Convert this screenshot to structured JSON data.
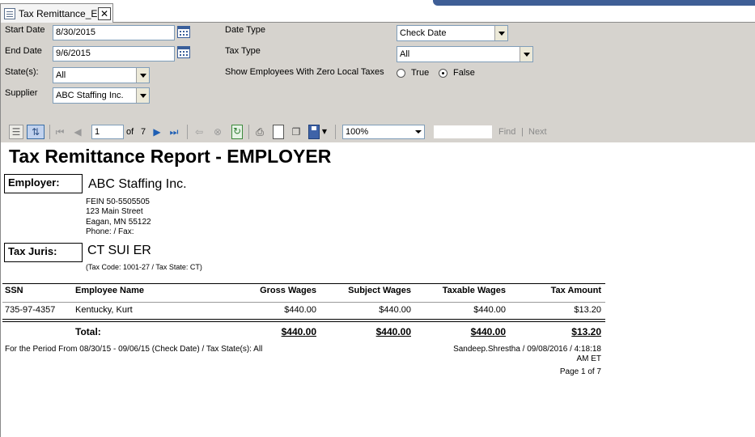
{
  "tab": {
    "title": "Tax Remittance_ER"
  },
  "params": {
    "start_date": {
      "label": "Start Date",
      "value": "8/30/2015"
    },
    "end_date": {
      "label": "End Date",
      "value": "9/6/2015"
    },
    "states": {
      "label": "State(s):",
      "value": "All"
    },
    "supplier": {
      "label": "Supplier",
      "value": "ABC Staffing Inc."
    },
    "date_type": {
      "label": "Date Type",
      "value": "Check Date"
    },
    "tax_type": {
      "label": "Tax Type",
      "value": "All"
    },
    "zero_local": {
      "label": "Show Employees With Zero Local Taxes",
      "true_label": "True",
      "false_label": "False",
      "selected": "False"
    }
  },
  "toolbar": {
    "page_current": "1",
    "page_of": "of",
    "page_total": "7",
    "zoom": "100%",
    "find_label": "Find",
    "separator": "|",
    "next_label": "Next"
  },
  "report": {
    "title": "Tax Remittance Report - EMPLOYER",
    "employer_label": "Employer:",
    "employer_name": "ABC Staffing Inc.",
    "fein": "FEIN 50-5505505",
    "address1": "123 Main Street",
    "address2": "Eagan, MN 55122",
    "phone": "Phone:  / Fax:",
    "tax_juris_label": "Tax Juris:",
    "tax_juris_name": "CT SUI ER",
    "tax_code_line": "(Tax Code: 1001-27 / Tax State: CT)",
    "columns": [
      "SSN",
      "Employee Name",
      "Gross Wages",
      "Subject Wages",
      "Taxable Wages",
      "Tax Amount"
    ],
    "rows": [
      {
        "ssn": "735-97-4357",
        "name": "Kentucky, Kurt",
        "gross": "$440.00",
        "subject": "$440.00",
        "taxable": "$440.00",
        "tax": "$13.20"
      }
    ],
    "totals": {
      "label": "Total:",
      "gross": "$440.00",
      "subject": "$440.00",
      "taxable": "$440.00",
      "tax": "$13.20"
    },
    "footer_period": "For the Period From 08/30/15 - 09/06/15 (Check Date) / Tax State(s): All",
    "footer_user_line1": "Sandeep.Shrestha / 09/08/2016 / 4:18:18",
    "footer_user_line2": "AM ET",
    "footer_page": "Page 1 of 7"
  }
}
